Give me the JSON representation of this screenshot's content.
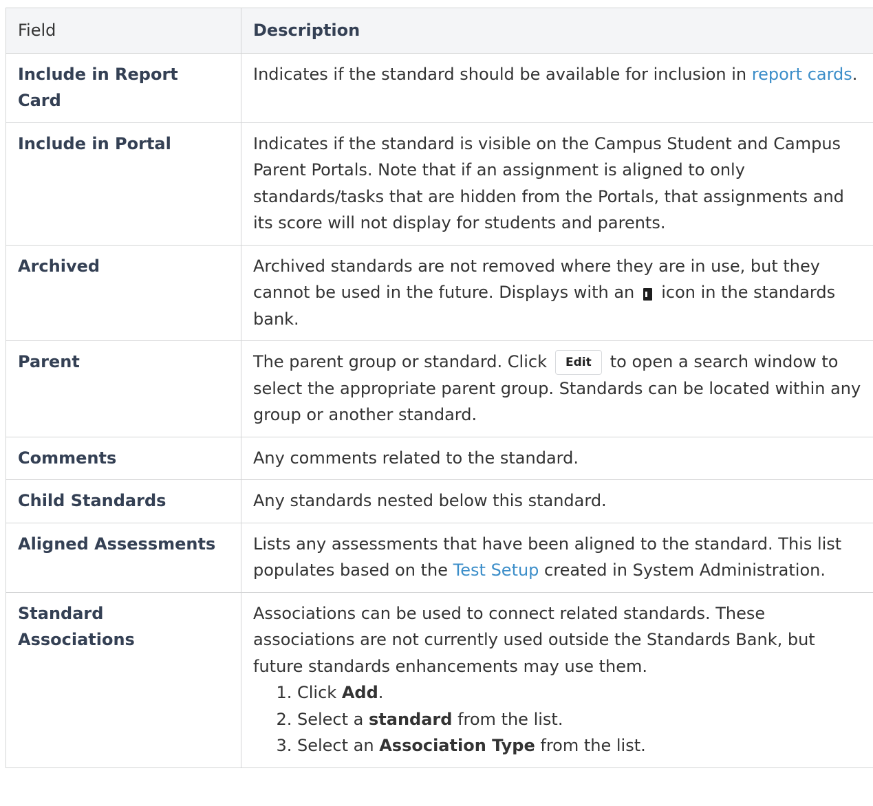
{
  "table": {
    "headers": {
      "field": "Field",
      "description": "Description"
    },
    "rows": {
      "report_card": {
        "field": [
          "Include in Report",
          "Card"
        ],
        "desc_before": "Indicates if the standard should be available for inclusion in ",
        "link": "report cards",
        "desc_after": "."
      },
      "portal": {
        "field": "Include in Portal",
        "desc": "Indicates if the standard is visible on the Campus Student and Campus Parent Portals. Note that if an assignment is aligned to only standards/tasks that are hidden from the Portals, that assignments and its score will not display for students and parents."
      },
      "archived": {
        "field": "Archived",
        "desc_before": "Archived standards are not removed where they are in use, but they cannot be used in the future. Displays with an",
        "icon": "archive-icon",
        "desc_after": "icon in the standards bank."
      },
      "parent": {
        "field": "Parent",
        "desc_before": "The parent group or standard. Click",
        "button": "Edit",
        "desc_after": "to open a search window to select the appropriate parent group. Standards can be located within any group or another standard."
      },
      "comments": {
        "field": "Comments",
        "desc": "Any comments related to the standard."
      },
      "child_standards": {
        "field": "Child Standards",
        "desc": "Any standards nested below this standard."
      },
      "aligned_assessments": {
        "field": "Aligned Assessments",
        "desc_before": "Lists any assessments that have been aligned to the standard. This list populates based on the ",
        "link": "Test Setup",
        "desc_after": " created in System Administration."
      },
      "standard_associations": {
        "field": [
          "Standard",
          "Associations"
        ],
        "desc": "Associations can be used to connect related standards. These associations are not currently used outside the Standards Bank, but future standards enhancements may use them.",
        "steps": [
          {
            "before": "Click ",
            "bold": "Add",
            "after": "."
          },
          {
            "before": "Select a ",
            "bold": "standard",
            "after": " from the list."
          },
          {
            "before": "Select an ",
            "bold": "Association Type",
            "after": " from the list."
          }
        ]
      }
    }
  }
}
